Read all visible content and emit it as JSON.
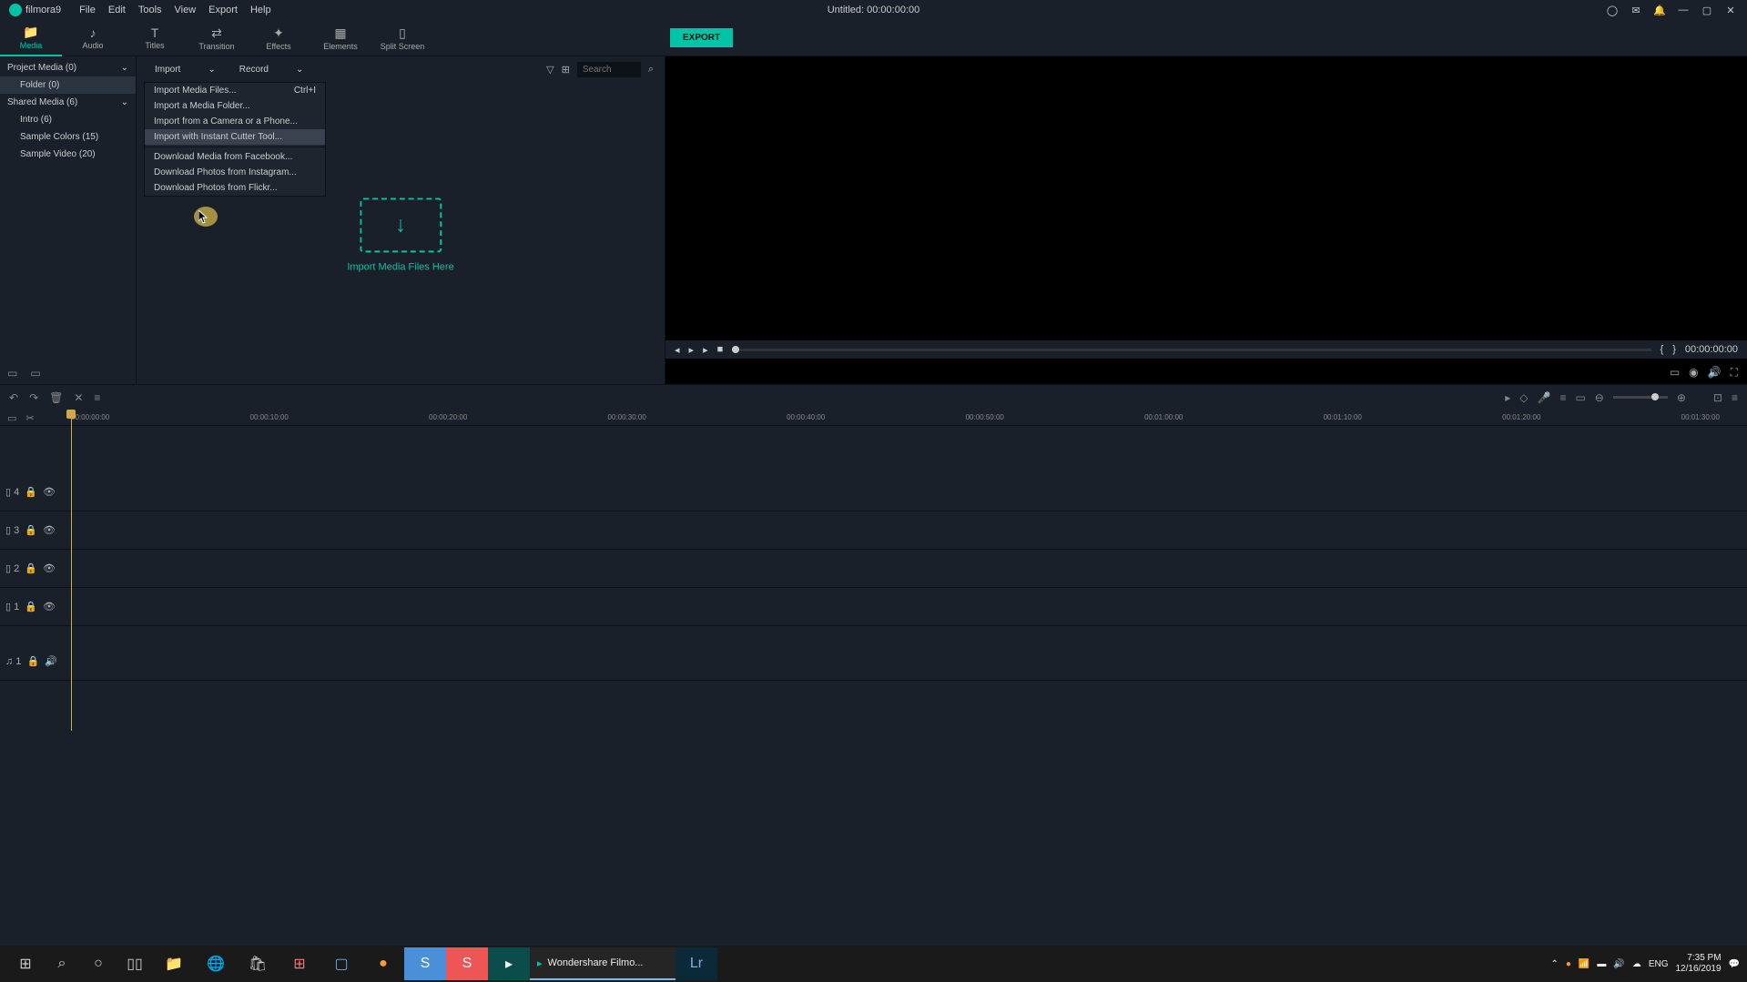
{
  "titlebar": {
    "app_name": "filmora9",
    "menu": [
      "File",
      "Edit",
      "Tools",
      "View",
      "Export",
      "Help"
    ],
    "project_title": "Untitled:  00:00:00:00"
  },
  "tabs": [
    {
      "label": "Media",
      "icon": "📁"
    },
    {
      "label": "Audio",
      "icon": "♪"
    },
    {
      "label": "Titles",
      "icon": "T"
    },
    {
      "label": "Transition",
      "icon": "⇄"
    },
    {
      "label": "Effects",
      "icon": "✦"
    },
    {
      "label": "Elements",
      "icon": "▦"
    },
    {
      "label": "Split Screen",
      "icon": "▯"
    }
  ],
  "export_label": "EXPORT",
  "sidebar": {
    "header1": "Project Media (0)",
    "item1": "Folder (0)",
    "header2": "Shared Media (6)",
    "item2": "Intro (6)",
    "item3": "Sample Colors (15)",
    "item4": "Sample Video (20)"
  },
  "media_toolbar": {
    "import": "Import",
    "record": "Record",
    "search_placeholder": "Search"
  },
  "import_menu": [
    {
      "label": "Import Media Files...",
      "shortcut": "Ctrl+I"
    },
    {
      "label": "Import a Media Folder..."
    },
    {
      "label": "Import from a Camera or a Phone..."
    },
    {
      "label": "Import with Instant Cutter Tool..."
    },
    {
      "sep": true
    },
    {
      "label": "Download Media from Facebook..."
    },
    {
      "label": "Download Photos from Instagram..."
    },
    {
      "label": "Download Photos from Flickr..."
    }
  ],
  "import_drop_text": "Import Media Files Here",
  "player": {
    "time": "00:00:00:00"
  },
  "timeline_ruler": [
    "00:00:00:00",
    "00:00:10:00",
    "00:00:20:00",
    "00:00:30:00",
    "00:00:40:00",
    "00:00:50:00",
    "00:01:00:00",
    "00:01:10:00",
    "00:01:20:00",
    "00:01:30:00"
  ],
  "tracks": [
    {
      "label": "▯ 4"
    },
    {
      "label": "▯ 3"
    },
    {
      "label": "▯ 2"
    },
    {
      "label": "▯ 1"
    },
    {
      "label": "♫ 1"
    }
  ],
  "taskbar": {
    "running": "Wondershare Filmo...",
    "lang": "ENG",
    "time": "7:35 PM",
    "date": "12/16/2019"
  }
}
